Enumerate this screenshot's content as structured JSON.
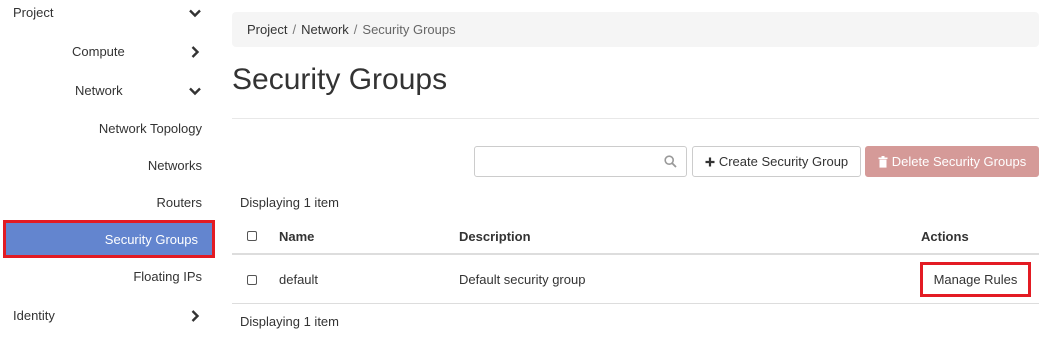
{
  "sidebar": {
    "project": "Project",
    "compute": "Compute",
    "network": "Network",
    "network_items": [
      "Network Topology",
      "Networks",
      "Routers",
      "Security Groups",
      "Floating IPs"
    ],
    "identity": "Identity"
  },
  "breadcrumb": [
    "Project",
    "Network",
    "Security Groups"
  ],
  "page": {
    "title": "Security Groups"
  },
  "toolbar": {
    "search_value": "",
    "create_label": "Create Security Group",
    "delete_label": "Delete Security Groups"
  },
  "table": {
    "count_top": "Displaying 1 item",
    "count_bottom": "Displaying 1 item",
    "headers": [
      "Name",
      "Description",
      "Actions"
    ],
    "rows": [
      {
        "name": "default",
        "description": "Default security group",
        "action": "Manage Rules"
      }
    ]
  },
  "colors": {
    "active_item_bg": "#6385cf",
    "highlight_border": "#e31b23",
    "delete_button_bg": "#d59a98"
  }
}
